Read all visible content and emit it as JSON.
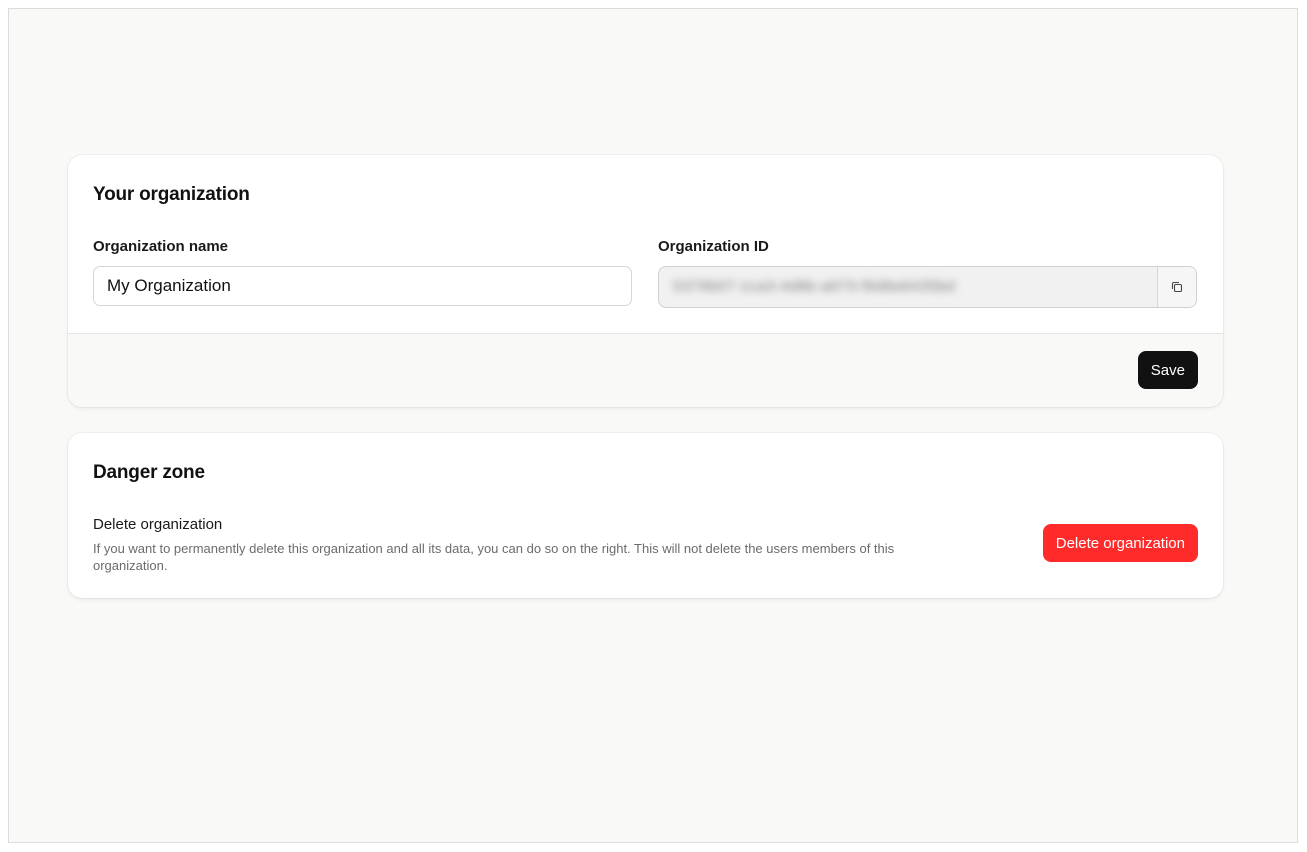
{
  "organization": {
    "title": "Your organization",
    "name_label": "Organization name",
    "name_value": "My Organization",
    "id_label": "Organization ID",
    "id_value": "5379b07-1ca3-4d8b-a673-f6d6e6435bd",
    "copy_icon": "copy-icon",
    "save_label": "Save"
  },
  "danger": {
    "title": "Danger zone",
    "delete_title": "Delete organization",
    "delete_description": "If you want to permanently delete this organization and all its data, you can do so on the right. This will not delete the users members of this organization.",
    "delete_button_label": "Delete organization",
    "button_color": "#ff2a2a"
  }
}
